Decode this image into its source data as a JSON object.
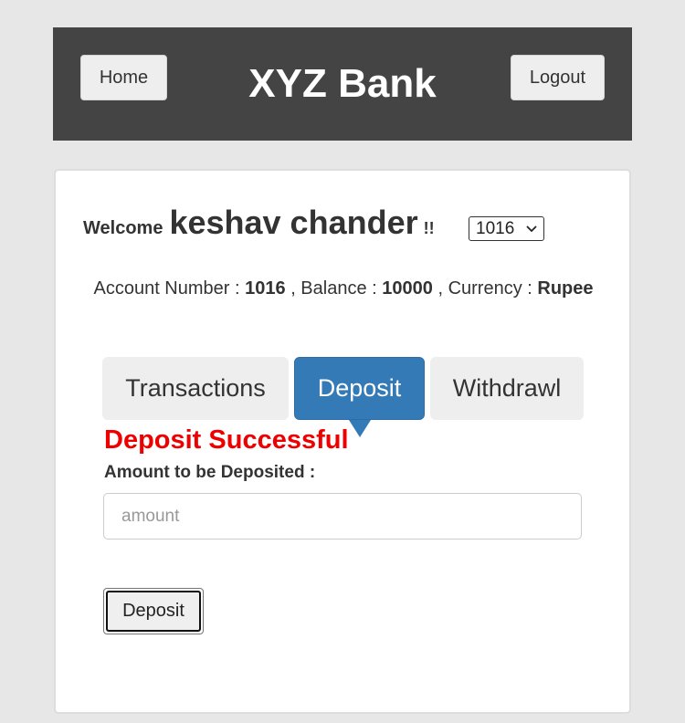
{
  "header": {
    "home_label": "Home",
    "title": "XYZ Bank",
    "logout_label": "Logout"
  },
  "welcome": {
    "prefix": "Welcome",
    "user_name": "keshav chander",
    "suffix": "!!",
    "account_select_value": "1016"
  },
  "account_info": {
    "number_label": "Account Number :",
    "number": "1016",
    "balance_label": ", Balance :",
    "balance": "10000",
    "currency_label": ", Currency :",
    "currency": "Rupee"
  },
  "tabs": [
    {
      "label": "Transactions",
      "active": false
    },
    {
      "label": "Deposit",
      "active": true
    },
    {
      "label": "Withdrawl",
      "active": false
    }
  ],
  "deposit_form": {
    "success_message": "Deposit Successful",
    "amount_label": "Amount to be Deposited :",
    "amount_value": "",
    "amount_placeholder": "amount",
    "submit_label": "Deposit"
  },
  "colors": {
    "header_bg": "#444444",
    "active_tab": "#337ab7",
    "success_text": "#ee0000",
    "page_bg": "#e7e7e7"
  }
}
